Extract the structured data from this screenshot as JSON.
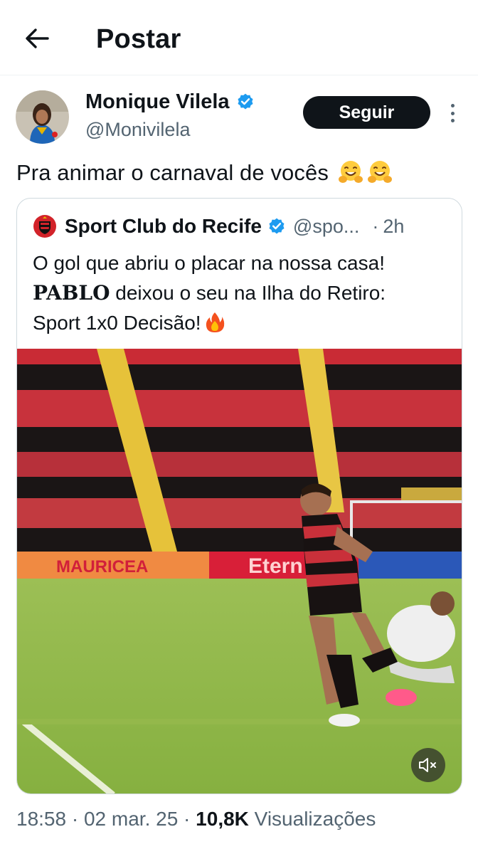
{
  "header": {
    "title": "Postar"
  },
  "author": {
    "name": "Monique Vilela",
    "handle": "@Monivilela",
    "follow_label": "Seguir"
  },
  "post": {
    "text": "Pra animar o carnaval de vocês"
  },
  "quoted_post": {
    "author_name": "Sport Club do Recife",
    "author_handle": "@spo...",
    "separator": "·",
    "time": "2h",
    "line1": "O gol que abriu o placar na nossa casa!",
    "bold_word": "PABLO",
    "line2_rest": " deixou o seu na Ilha do Retiro:",
    "line3": "Sport 1x0 Decisão!",
    "media": {
      "ad_board_1": "MAURICEA",
      "ad_board_2": "Etern"
    }
  },
  "meta": {
    "time": "18:58",
    "sep1": " · ",
    "date": "02 mar. 25",
    "sep2": " · ",
    "views_count": "10,8K",
    "views_label": " Visualizações"
  },
  "colors": {
    "text_primary": "#0f1419",
    "text_secondary": "#536471",
    "verified_blue": "#1d9bf0",
    "border": "#cfd9de"
  },
  "icons": {
    "back": "arrow-left-icon",
    "verified": "verified-badge-icon",
    "more": "more-vertical-icon",
    "club_logo": "sport-recife-crest-icon",
    "hug_emoji": "hugging-face-emoji",
    "fire_emoji": "fire-emoji",
    "mute": "speaker-muted-icon"
  }
}
